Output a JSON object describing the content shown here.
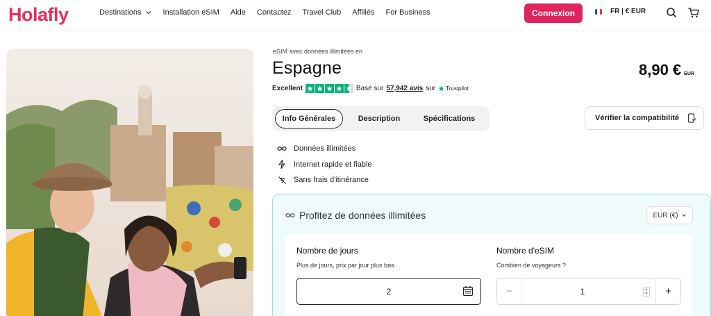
{
  "header": {
    "logo": "Holafly",
    "nav": [
      {
        "label": "Destinations",
        "has_dropdown": true
      },
      {
        "label": "Installation eSIM"
      },
      {
        "label": "Aide"
      },
      {
        "label": "Contactez"
      },
      {
        "label": "Travel Club"
      },
      {
        "label": "Affiliés"
      },
      {
        "label": "For Business"
      }
    ],
    "login_label": "Connexion",
    "locale_label": "FR | € EUR",
    "icons": [
      "france-flag-icon",
      "search-icon",
      "cart-icon"
    ]
  },
  "product": {
    "eyebrow": "eSIM avec données illimitées en",
    "title": "Espagne",
    "price": "8,90 €",
    "price_currency": "EUR",
    "rating": {
      "label": "Excellent",
      "stars": 4.5,
      "based_on": "Basé sur",
      "reviews_link": "57,942 avis",
      "on": "sur",
      "provider": "Trustpilot"
    }
  },
  "tabs": [
    {
      "label": "Info Générales",
      "active": true
    },
    {
      "label": "Description"
    },
    {
      "label": "Spécifications"
    }
  ],
  "compat_button": "Vérifier la compatibilité",
  "features": [
    {
      "icon": "infinity-icon",
      "label": "Données illimitées"
    },
    {
      "icon": "lightning-icon",
      "label": "Internet rapide et fiable"
    },
    {
      "icon": "no-roaming-icon",
      "label": "Sans frais d'itinérance"
    }
  ],
  "config": {
    "title": "Profitez de données illimitées",
    "currency": "EUR (€)",
    "days": {
      "title": "Nombre de jours",
      "subtitle": "Plus de jours, prix par jour plus bas",
      "value": "2"
    },
    "esims": {
      "title": "Nombre d'eSIM",
      "subtitle": "Combien de voyageurs ?",
      "value": "1",
      "minus": "−",
      "plus": "+"
    }
  },
  "colors": {
    "brand": "#e0245e",
    "trustpilot": "#00b67a",
    "panel_bg": "#f0fbfb",
    "panel_border": "#9fe0d4"
  }
}
